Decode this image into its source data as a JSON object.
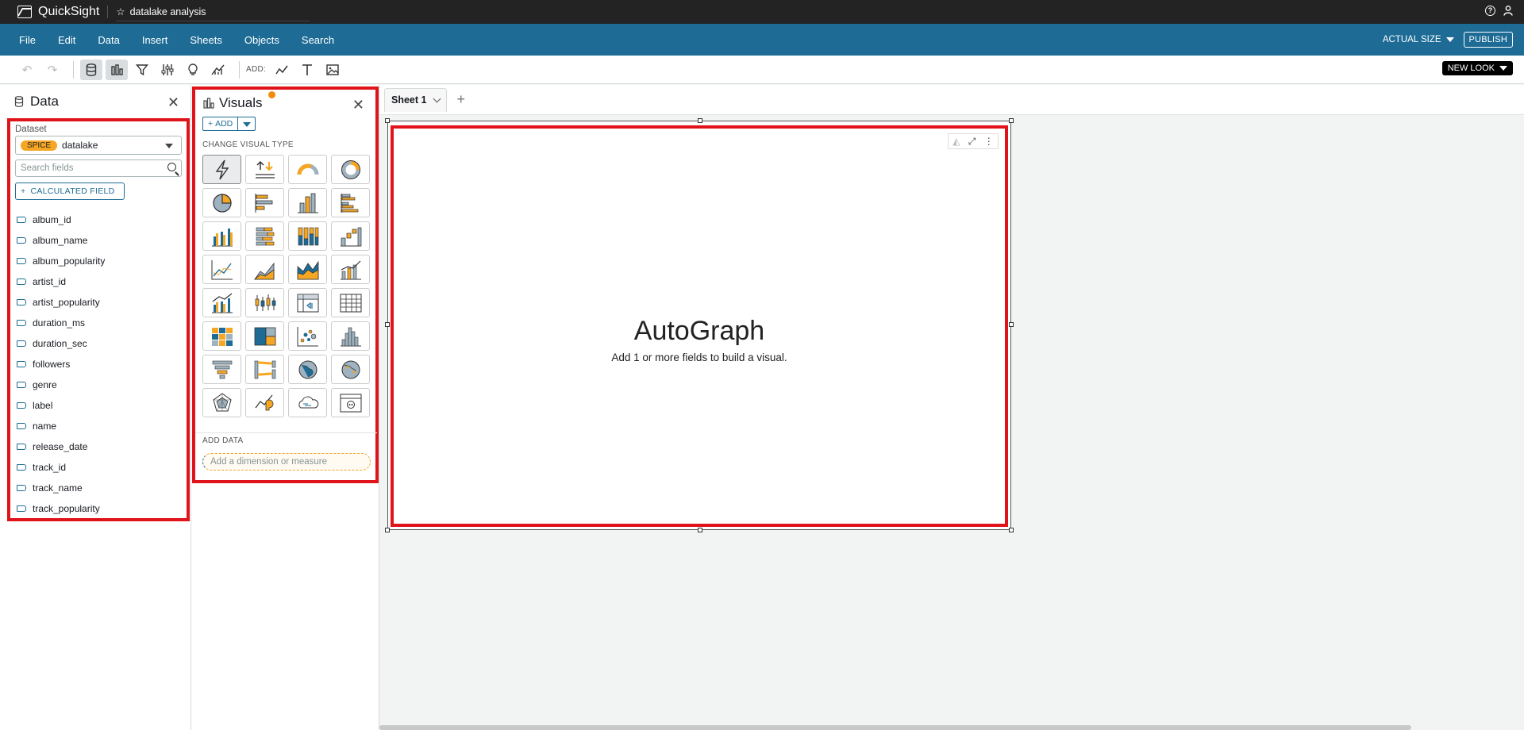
{
  "app": {
    "name": "QuickSight",
    "analysis_title": "datalake analysis"
  },
  "menubar": {
    "items": [
      "File",
      "Edit",
      "Data",
      "Insert",
      "Sheets",
      "Objects",
      "Search"
    ],
    "actual_size": "ACTUAL SIZE",
    "publish": "PUBLISH"
  },
  "toolbar": {
    "add_label": "ADD:",
    "new_look": "NEW LOOK"
  },
  "data_panel": {
    "title": "Data",
    "dataset_label": "Dataset",
    "spice_badge": "SPICE",
    "dataset_name": "datalake",
    "search_placeholder": "Search fields",
    "calculated_field": "CALCULATED FIELD",
    "fields": [
      "album_id",
      "album_name",
      "album_popularity",
      "artist_id",
      "artist_popularity",
      "duration_ms",
      "duration_sec",
      "followers",
      "genre",
      "label",
      "name",
      "release_date",
      "track_id",
      "track_name",
      "track_popularity"
    ]
  },
  "visuals_panel": {
    "title": "Visuals",
    "add_button": "ADD",
    "change_type_label": "CHANGE VISUAL TYPE",
    "add_data_label": "ADD DATA",
    "drop_placeholder": "Add a dimension or measure"
  },
  "sheets": {
    "tabs": [
      "Sheet 1"
    ]
  },
  "visual": {
    "title": "AutoGraph",
    "subtitle": "Add 1 or more fields to build a visual."
  },
  "colors": {
    "accent": "#1e6c96",
    "highlight": "#e0131a",
    "spice": "#f5a623",
    "topbar": "#232323"
  }
}
